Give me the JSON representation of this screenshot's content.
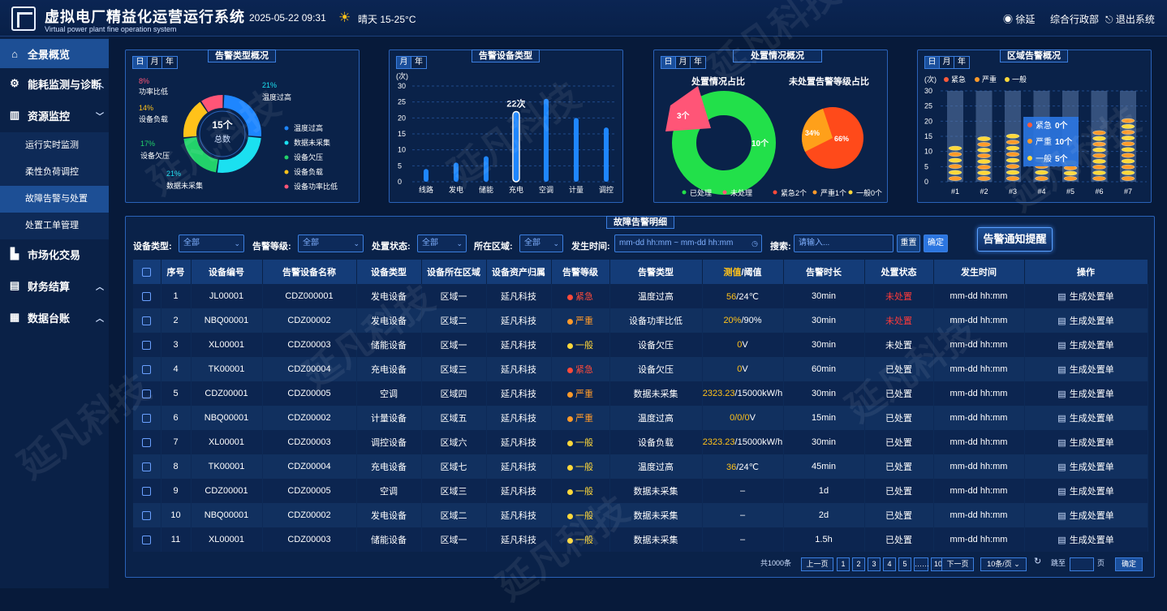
{
  "header": {
    "title": "虚拟电厂精益化运营运行系统",
    "subtitle": "Virtual power plant fine operation system",
    "datetime": "2025-05-22 09:31",
    "weather": "晴天  15-25°C",
    "user": "徐延",
    "dept": "综合行政部",
    "logout": "退出系统"
  },
  "sidebar": {
    "items": [
      {
        "label": "全景概览",
        "icon": "home-icon"
      },
      {
        "label": "能耗监测与诊断",
        "icon": "energy-icon"
      },
      {
        "label": "资源监控",
        "icon": "monitor-icon"
      },
      {
        "label": "市场化交易",
        "icon": "market-icon"
      },
      {
        "label": "财务结算",
        "icon": "finance-icon"
      },
      {
        "label": "数据台账",
        "icon": "ledger-icon"
      }
    ],
    "sub": [
      "运行实时监测",
      "柔性负荷调控",
      "故障告警与处置",
      "处置工单管理"
    ]
  },
  "colors": {
    "accent": "#2b75e0",
    "urgent": "#ff4a3a",
    "severe": "#ff9a2a",
    "general": "#ffd83a",
    "processed": "#22e04a"
  },
  "alarm_type": {
    "title": "告警类型概况",
    "seg": [
      "日",
      "月",
      "年"
    ],
    "total_value": "15个",
    "total_label": "总数",
    "slices": [
      {
        "name": "温度过高",
        "pct": "21%",
        "value": 21,
        "color": "#1e86ff"
      },
      {
        "name": "数据未采集",
        "pct": "21%",
        "value": 21,
        "color": "#1be0f0"
      },
      {
        "name": "设备欠压",
        "pct": "17%",
        "value": 17,
        "color": "#22d26a"
      },
      {
        "name": "设备负载",
        "pct": "14%",
        "value": 14,
        "color": "#ffc21a"
      },
      {
        "name": "设备功率比低",
        "pct": "8%",
        "value": 8,
        "color": "#ff5577"
      }
    ],
    "labels": {
      "power_low": "功率比低",
      "equip_load": "设备负载",
      "under_volt": "设备欠压",
      "data_missing": "数据未采集",
      "temp_high": "温度过高"
    }
  },
  "alarm_device": {
    "title": "告警设备类型",
    "seg": [
      "月",
      "年"
    ],
    "unit": "(次)",
    "highlight": "22次",
    "chart_data": {
      "type": "bar",
      "categories": [
        "线路",
        "发电",
        "储能",
        "充电",
        "空调",
        "计量",
        "调控"
      ],
      "values": [
        4,
        6,
        8,
        22,
        26,
        20,
        17
      ],
      "ylim": [
        0,
        30
      ],
      "yticks": [
        0,
        5,
        10,
        15,
        20,
        25,
        30
      ]
    }
  },
  "handling": {
    "title": "处置情况概况",
    "seg": [
      "日",
      "月",
      "年"
    ],
    "left_title": "处置情况占比",
    "right_title": "未处置告警等级占比",
    "processed": "10个",
    "unprocessed": "3个",
    "legend": [
      "已处理",
      "未处理",
      "紧急2个",
      "严重1个",
      "一般0个"
    ],
    "pct_a": "34%",
    "pct_b": "66%"
  },
  "region": {
    "title": "区域告警概况",
    "seg": [
      "日",
      "月",
      "年"
    ],
    "unit": "(次)",
    "legend": [
      "紧急",
      "严重",
      "一般"
    ],
    "tooltip": [
      {
        "label": "紧急",
        "value": "0个"
      },
      {
        "label": "严重",
        "value": "10个"
      },
      {
        "label": "一般",
        "value": "5个"
      }
    ],
    "chart_data": {
      "type": "bar",
      "categories": [
        "#1",
        "#2",
        "#3",
        "#4",
        "#5",
        "#6",
        "#7"
      ],
      "values": [
        12,
        15,
        16,
        8,
        7,
        17,
        21
      ],
      "ylim": [
        0,
        30
      ],
      "yticks": [
        0,
        5,
        10,
        15,
        20,
        25,
        30
      ]
    }
  },
  "detail": {
    "title": "故障告警明细",
    "notify": "告警通知提醒",
    "filters": {
      "type_label": "设备类型:",
      "type_val": "全部",
      "level_label": "告警等级:",
      "level_val": "全部",
      "status_label": "处置状态:",
      "status_val": "全部",
      "area_label": "所在区域:",
      "area_val": "全部",
      "time_label": "发生时间:",
      "time_ph": "mm-dd hh:mm  ~  mm-dd hh:mm",
      "search_label": "搜索:",
      "search_ph": "请输入...",
      "reset": "重置",
      "ok": "确定"
    },
    "columns": [
      "序号",
      "设备编号",
      "告警设备名称",
      "设备类型",
      "设备所在区域",
      "设备资产归属",
      "告警等级",
      "告警类型",
      "测值/阈值",
      "告警时长",
      "处置状态",
      "发生时间",
      "操作"
    ],
    "rows": [
      [
        "1",
        "JL00001",
        "CDZ000001",
        "发电设备",
        "区域一",
        "延凡科技",
        "紧急",
        "温度过高",
        "56",
        "/24℃",
        "30min",
        "未处置",
        "mm-dd hh:mm",
        "生成处置单"
      ],
      [
        "2",
        "NBQ00001",
        "CDZ00002",
        "发电设备",
        "区域二",
        "延凡科技",
        "严重",
        "设备功率比低",
        "20%",
        "/90%",
        "30min",
        "未处置",
        "mm-dd hh:mm",
        "生成处置单"
      ],
      [
        "3",
        "XL00001",
        "CDZ00003",
        "储能设备",
        "区域一",
        "延凡科技",
        "一般",
        "设备欠压",
        "0",
        "V",
        "30min",
        "未处置",
        "mm-dd hh:mm",
        "生成处置单"
      ],
      [
        "4",
        "TK00001",
        "CDZ00004",
        "充电设备",
        "区域三",
        "延凡科技",
        "紧急",
        "设备欠压",
        "0",
        "V",
        "60min",
        "已处置",
        "mm-dd hh:mm",
        "生成处置单"
      ],
      [
        "5",
        "CDZ00001",
        "CDZ00005",
        "空调",
        "区域四",
        "延凡科技",
        "严重",
        "数据未采集",
        "2323.23",
        "/15000kW/h",
        "30min",
        "已处置",
        "mm-dd hh:mm",
        "生成处置单"
      ],
      [
        "6",
        "NBQ00001",
        "CDZ00002",
        "计量设备",
        "区域五",
        "延凡科技",
        "严重",
        "温度过高",
        "0/0/0",
        "V",
        "15min",
        "已处置",
        "mm-dd hh:mm",
        "生成处置单"
      ],
      [
        "7",
        "XL00001",
        "CDZ00003",
        "调控设备",
        "区域六",
        "延凡科技",
        "一般",
        "设备负载",
        "2323.23",
        "/15000kW/h",
        "30min",
        "已处置",
        "mm-dd hh:mm",
        "生成处置单"
      ],
      [
        "8",
        "TK00001",
        "CDZ00004",
        "充电设备",
        "区域七",
        "延凡科技",
        "一般",
        "温度过高",
        "36",
        "/24℃",
        "45min",
        "已处置",
        "mm-dd hh:mm",
        "生成处置单"
      ],
      [
        "9",
        "CDZ00001",
        "CDZ00005",
        "空调",
        "区域三",
        "延凡科技",
        "一般",
        "数据未采集",
        "–",
        "",
        "1d",
        "已处置",
        "mm-dd hh:mm",
        "生成处置单"
      ],
      [
        "10",
        "NBQ00001",
        "CDZ00002",
        "发电设备",
        "区域二",
        "延凡科技",
        "一般",
        "数据未采集",
        "–",
        "",
        "2d",
        "已处置",
        "mm-dd hh:mm",
        "生成处置单"
      ],
      [
        "11",
        "XL00001",
        "CDZ00003",
        "储能设备",
        "区域一",
        "延凡科技",
        "一般",
        "数据未采集",
        "–",
        "",
        "1.5h",
        "已处置",
        "mm-dd hh:mm",
        "生成处置单"
      ]
    ]
  },
  "pager": {
    "total": "共1000条",
    "prev": "上一页",
    "pages": [
      "1",
      "2",
      "3",
      "4",
      "5",
      "……",
      "10"
    ],
    "next": "下一页",
    "size": "10条/页",
    "goto": "跳至",
    "page_unit": "页",
    "ok": "确定"
  },
  "watermark": "延凡科技"
}
